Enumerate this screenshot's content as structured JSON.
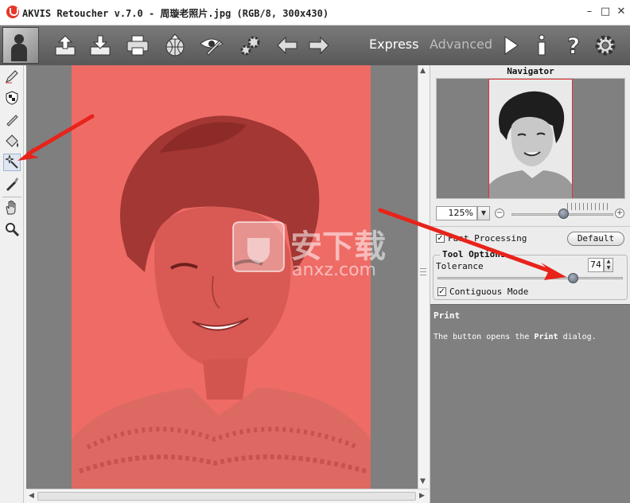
{
  "window": {
    "title": "AKVIS Retoucher v.7.0 - 周璇老照片.jpg (RGB/8, 300x430)",
    "minimize": "–",
    "maximize": "□",
    "close": "✕"
  },
  "toolbar": {
    "buttons": [
      "open-icon",
      "save-icon",
      "print-icon",
      "share-icon",
      "preferences-icon",
      "plugins-icon",
      "undo-icon",
      "redo-icon"
    ],
    "mode_express": "Express",
    "mode_advanced": "Advanced",
    "right_buttons": [
      "run-icon",
      "info-icon",
      "help-icon",
      "settings-icon"
    ]
  },
  "tools": [
    "retouch-pencil-icon",
    "eraser-shield-icon",
    "patch-brush-icon",
    "bucket-fill-icon",
    "magic-wand-icon",
    "clone-brush-icon",
    "hand-icon",
    "zoom-icon"
  ],
  "navigator": {
    "title": "Navigator",
    "zoom": "125%",
    "zoom_level": 0.47
  },
  "options": {
    "fast_processing_label": "Fast Processing",
    "fast_processing_checked": "✓",
    "default_label": "Default",
    "tool_options_title": "Tool Options",
    "tolerance_label": "Tolerance",
    "tolerance_value": "74",
    "tolerance_level": 0.74,
    "contiguous_label": "Contiguous Mode",
    "contiguous_checked": "✓"
  },
  "help": {
    "title": "Print",
    "text_pre": "The button opens the ",
    "text_bold": "Print",
    "text_post": " dialog."
  },
  "watermark": {
    "text": "安下载",
    "domain": "anxz.com"
  },
  "colors": {
    "mask_red": "#ef6b66",
    "annotation_red": "#e8231a"
  }
}
